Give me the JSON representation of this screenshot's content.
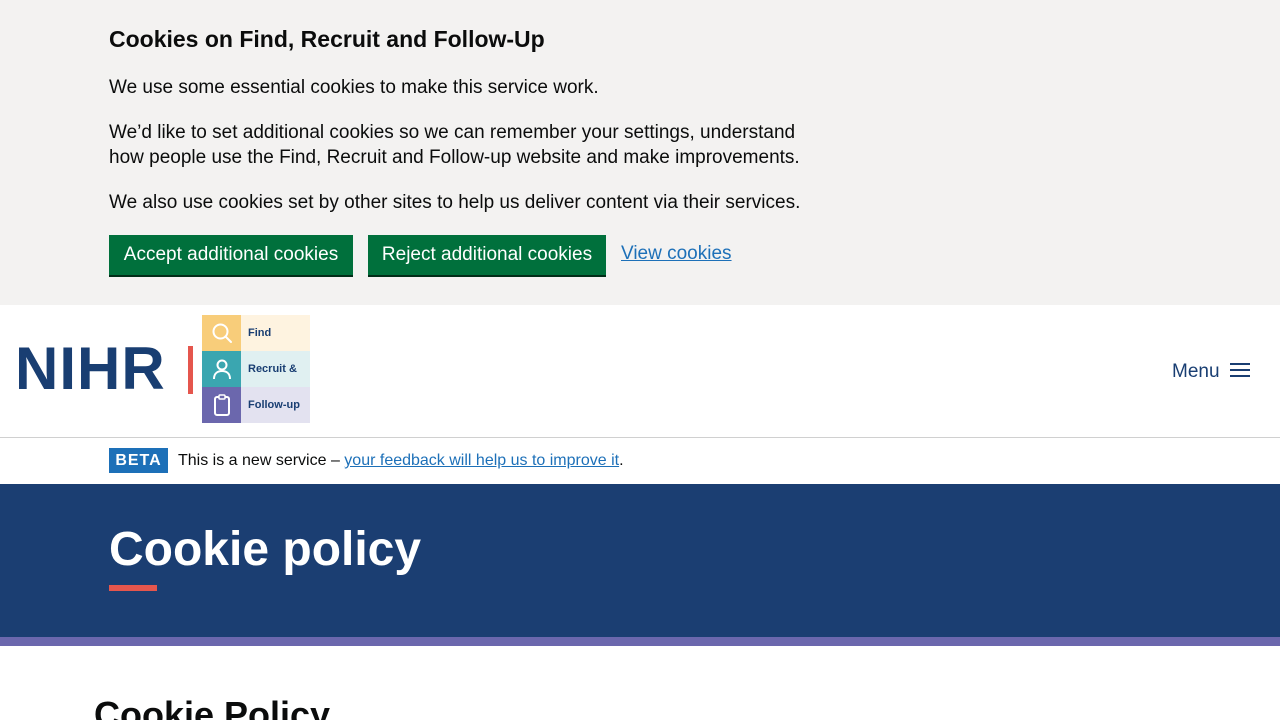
{
  "cookie_banner": {
    "title": "Cookies on Find, Recruit and Follow-Up",
    "paragraph_1": "We use some essential cookies to make this service work.",
    "paragraph_2": "We’d like to set additional cookies so we can remember your settings, understand how people use the Find, Recruit and Follow-up website and make improvements.",
    "paragraph_3": "We also use cookies set by other sites to help us deliver content via their services.",
    "accept_label": "Accept additional cookies",
    "reject_label": "Reject additional cookies",
    "view_link": "View cookies",
    "button_color": "#00703c",
    "link_color": "#1d70b8"
  },
  "header": {
    "logo": {
      "org": "NIHR",
      "rows": [
        {
          "label": "Find",
          "icon": "search-icon"
        },
        {
          "label": "Recruit &",
          "icon": "person-icon"
        },
        {
          "label": "Follow-up",
          "icon": "clipboard-icon"
        }
      ]
    },
    "menu_label": "Menu",
    "menu_icon": "hamburger-icon"
  },
  "beta": {
    "tag": "BETA",
    "text": "This is a new service –",
    "link": "your feedback will help us to improve it",
    "end": "."
  },
  "hero": {
    "title": "Cookie policy",
    "background": "#1b3e72",
    "accent": "#e5564d",
    "strip_color": "#6b67ad"
  },
  "content": {
    "heading": "Cookie Policy"
  }
}
